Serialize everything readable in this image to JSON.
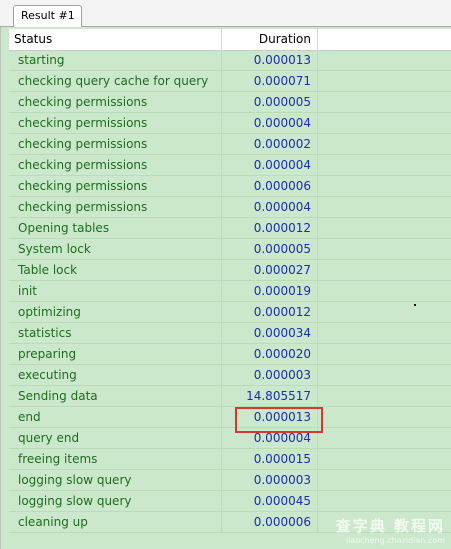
{
  "tab": {
    "label": "Result #1"
  },
  "columns": {
    "status": "Status",
    "duration": "Duration"
  },
  "rows": [
    {
      "status": "starting",
      "duration": "0.000013"
    },
    {
      "status": "checking query cache for query",
      "duration": "0.000071"
    },
    {
      "status": "checking permissions",
      "duration": "0.000005"
    },
    {
      "status": "checking permissions",
      "duration": "0.000004"
    },
    {
      "status": "checking permissions",
      "duration": "0.000002"
    },
    {
      "status": "checking permissions",
      "duration": "0.000004"
    },
    {
      "status": "checking permissions",
      "duration": "0.000006"
    },
    {
      "status": "checking permissions",
      "duration": "0.000004"
    },
    {
      "status": "Opening tables",
      "duration": "0.000012"
    },
    {
      "status": "System lock",
      "duration": "0.000005"
    },
    {
      "status": "Table lock",
      "duration": "0.000027"
    },
    {
      "status": "init",
      "duration": "0.000019"
    },
    {
      "status": "optimizing",
      "duration": "0.000012"
    },
    {
      "status": "statistics",
      "duration": "0.000034"
    },
    {
      "status": "preparing",
      "duration": "0.000020"
    },
    {
      "status": "executing",
      "duration": "0.000003"
    },
    {
      "status": "Sending data",
      "duration": "14.805517"
    },
    {
      "status": "end",
      "duration": "0.000013"
    },
    {
      "status": "query end",
      "duration": "0.000004"
    },
    {
      "status": "freeing items",
      "duration": "0.000015"
    },
    {
      "status": "logging slow query",
      "duration": "0.000003"
    },
    {
      "status": "logging slow query",
      "duration": "0.000045"
    },
    {
      "status": "cleaning up",
      "duration": "0.000006"
    }
  ],
  "watermark": {
    "title": "查字典 教程网",
    "url": "jiaocheng.chazidian.com"
  },
  "colors": {
    "background": "#cce8cc",
    "status_text": "#1c6e1c",
    "duration_text": "#1a2fa8",
    "highlight": "#d63a2e"
  }
}
